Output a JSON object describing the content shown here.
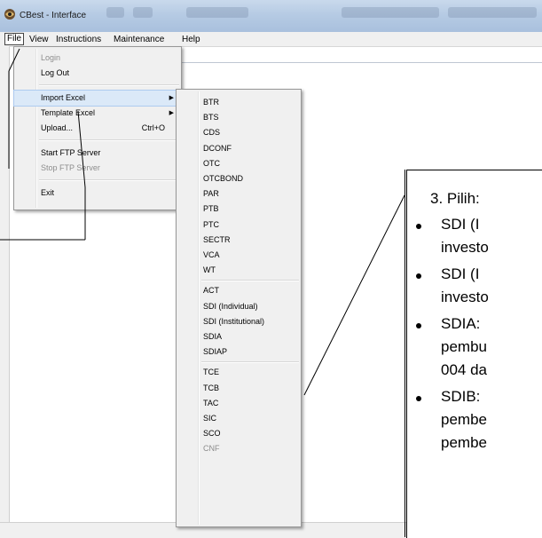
{
  "window": {
    "title": "CBest - Interface"
  },
  "menubar": [
    "File",
    "View",
    "Instructions",
    "Maintenance",
    "Help"
  ],
  "file_menu": [
    {
      "label": "Login",
      "disabled": true
    },
    {
      "label": "Log Out",
      "disabled": false
    },
    {
      "label": "Import Excel",
      "submenu": true,
      "highlighted": true
    },
    {
      "label": "Template Excel",
      "submenu": true
    },
    {
      "label": "Upload...",
      "shortcut": "Ctrl+O"
    },
    {
      "label": "Start FTP Server",
      "disabled": false
    },
    {
      "label": "Stop FTP Server",
      "disabled": true
    },
    {
      "label": "Exit",
      "disabled": false
    }
  ],
  "import_submenu": {
    "group1": [
      "BTR",
      "BTS",
      "CDS",
      "DCONF",
      "OTC",
      "OTCBOND",
      "PAR",
      "PTB",
      "PTC",
      "SECTR",
      "VCA",
      "WT"
    ],
    "group2": [
      "ACT",
      "SDI (Individual)",
      "SDI (Institutional)",
      "SDIA",
      "SDIAP"
    ],
    "group3": [
      "TCE",
      "TCB",
      "TAC",
      "SIC",
      "SCO",
      "CNF"
    ],
    "disabled": [
      "CNF"
    ]
  },
  "callout": {
    "heading": "3. Pilih:",
    "bullets": [
      {
        "line1": "SDI   (I",
        "line2": "investo"
      },
      {
        "line1": "SDI   (I",
        "line2": "investo"
      },
      {
        "line1": "SDIA:",
        "line2": "pembu",
        "line3": "004 da"
      },
      {
        "line1": "SDIB:",
        "line2": "pembe",
        "line3": "pembe"
      }
    ]
  },
  "colors": {
    "menu_bg": "#f0f0f0",
    "highlight": "#dbe9f8",
    "titlebar": "#b6cbe4"
  }
}
